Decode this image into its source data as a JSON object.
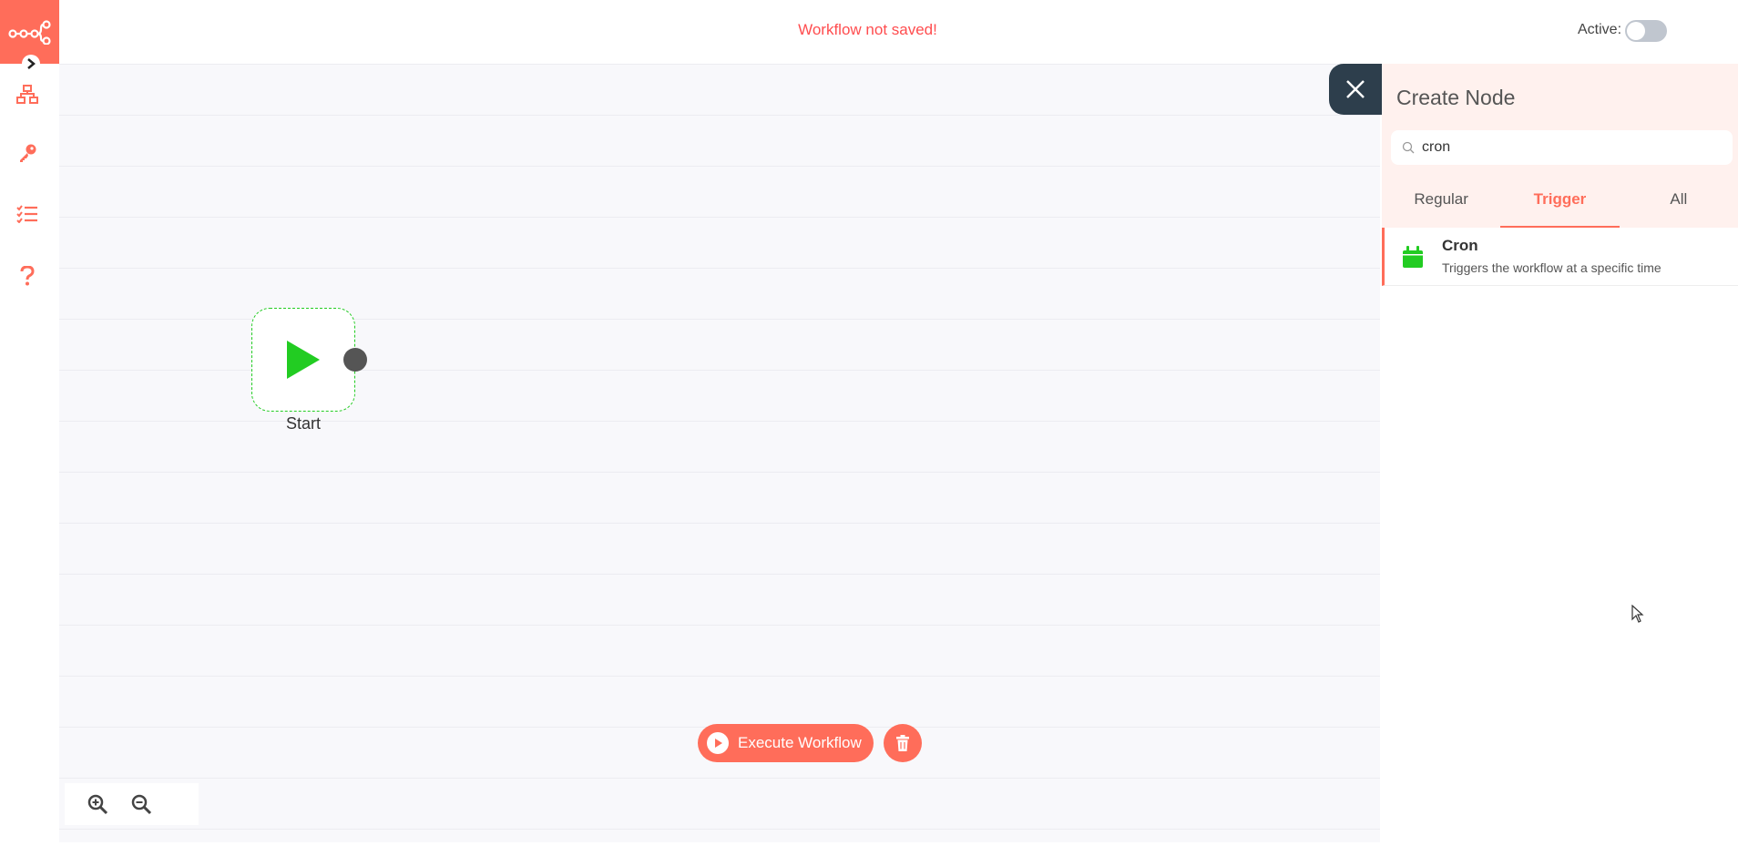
{
  "header": {
    "save_status": "Workflow not saved!",
    "active_label": "Active:",
    "active": false
  },
  "sidebar": {
    "items": [
      {
        "icon": "network-icon"
      },
      {
        "icon": "key-icon"
      },
      {
        "icon": "checklist-icon"
      },
      {
        "icon": "help-icon"
      }
    ]
  },
  "canvas": {
    "nodes": [
      {
        "label": "Start",
        "icon": "play-icon"
      }
    ]
  },
  "toolbar": {
    "execute_label": "Execute Workflow"
  },
  "panel": {
    "title": "Create Node",
    "search_value": "cron",
    "tabs": [
      {
        "label": "Regular",
        "active": false
      },
      {
        "label": "Trigger",
        "active": true
      },
      {
        "label": "All",
        "active": false
      }
    ],
    "results": [
      {
        "name": "Cron",
        "description": "Triggers the workflow at a specific time",
        "icon": "calendar-icon"
      }
    ]
  },
  "colors": {
    "accent": "#ff6d5a",
    "error": "#ff4d4f",
    "dark": "#2d3e4c",
    "node_green": "#22cc22"
  }
}
